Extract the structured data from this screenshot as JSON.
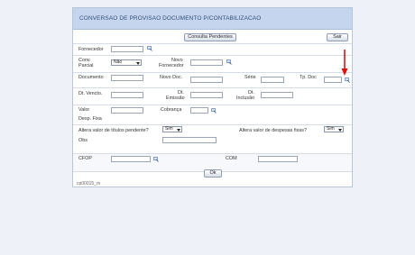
{
  "title": "CONVERSAO DE PROVISAO DOCUMENTO P/CONTABILIZACAO",
  "buttons": {
    "consulta": "Consulta Pendentes",
    "sair": "Sair",
    "ok": "Ok"
  },
  "labels": {
    "fornecedor": "Fornecedor",
    "conv": "Conv.",
    "parcial": "Parcial",
    "novo": "Novo",
    "fornecedor2": "Fornecedor",
    "documento": "Documento",
    "novo_doc": "Novo Doc.",
    "serie": "Série",
    "tp_doc": "Tp. Doc",
    "dt_vencto": "Dt. Vencto.",
    "dt": "Dt.",
    "emissao": "Emissão",
    "dt2": "Dt.",
    "inclusao": "Inclusão",
    "valor": "Valor",
    "cobranca": "Cobrança",
    "desp_fixa": "Desp. Fixa",
    "altera_pendente": "Altera valor de títulos pendente?",
    "altera_despesas": "Altera valor de despesas fixas?",
    "obs": "Obs",
    "cfop": "CFOP",
    "com": "COM"
  },
  "selects": {
    "conv_parcial": "Não",
    "altera_pendente": "Sim",
    "altera_despesas": "Sim"
  },
  "footer": "cp00015_m",
  "colors": {
    "titlebar": "#c5d5ee",
    "title_text": "#33507a",
    "annotation_arrow": "#e01010"
  }
}
